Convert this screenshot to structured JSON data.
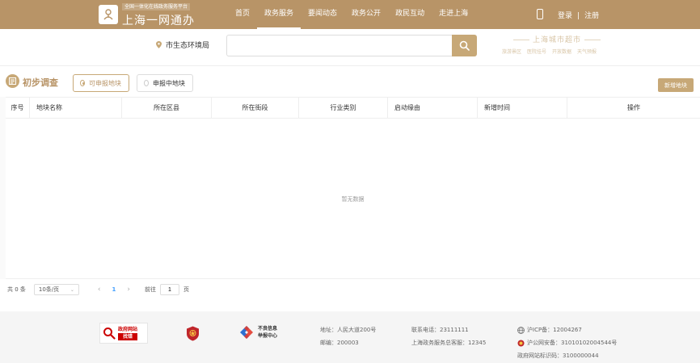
{
  "header": {
    "brand_subtitle": "全国一体化在线政务服务平台",
    "brand_title": "上海一网通办",
    "nav": [
      {
        "label": "首页"
      },
      {
        "label": "政务服务",
        "active": true
      },
      {
        "label": "要闻动态"
      },
      {
        "label": "政务公开"
      },
      {
        "label": "政民互动"
      },
      {
        "label": "走进上海"
      }
    ],
    "login": "登录",
    "separator": "|",
    "register": "注册"
  },
  "search": {
    "location": "市生态环境局",
    "placeholder": "",
    "value": ""
  },
  "city_brand": {
    "title": "上海城市超市",
    "links": [
      "旅游景区",
      "医院挂号",
      "开放数据",
      "天气预报"
    ]
  },
  "section": {
    "title": "初步调查",
    "tabs": [
      {
        "label": "可申报地块",
        "active": true
      },
      {
        "label": "申报中地块",
        "active": false
      }
    ],
    "add_button": "新增地块"
  },
  "table": {
    "columns": [
      "序号",
      "地块名称",
      "所在区县",
      "所在街段",
      "行业类别",
      "启动缘由",
      "新增时间",
      "操作"
    ],
    "rows": [],
    "empty_text": "暂无数据"
  },
  "pagination": {
    "total": "共 0 条",
    "page_size": "10条/页",
    "prev": "‹",
    "current_page": "1",
    "next": "›",
    "goto_label": "前往",
    "goto_value": "1",
    "page_suffix": "页"
  },
  "footer": {
    "gov_site_top": "政府网站",
    "gov_site_bottom": "找错",
    "report_line1": "不良信息",
    "report_line2": "举报中心",
    "address": "地址：人民大道200号",
    "postcode": "邮编：200003",
    "phone": "联系电话：23111111",
    "hotline": "上海政务服务总客服：12345",
    "icp": "沪ICP备：12004267",
    "police": "沪公网安备：31010102004544号",
    "site_code": "政府网站标识码：3100000044"
  },
  "colors": {
    "brand_gold": "#b89467",
    "accent_gold": "#c7a877",
    "link_blue": "#409eff"
  }
}
